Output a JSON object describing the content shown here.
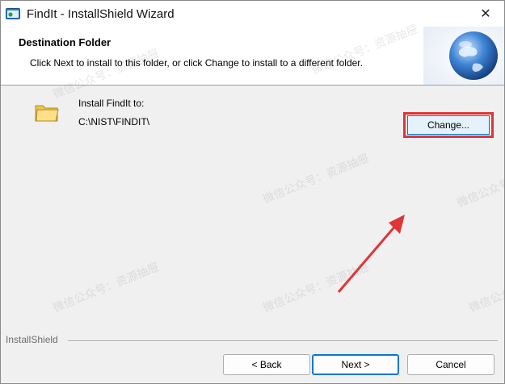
{
  "window": {
    "title": "FindIt - InstallShield Wizard",
    "close_symbol": "✕"
  },
  "banner": {
    "title": "Destination Folder",
    "description": "Click Next to install to this folder, or click Change to install to a different folder."
  },
  "content": {
    "install_label": "Install FindIt to:",
    "install_path": "C:\\NIST\\FINDIT\\",
    "change_label": "Change..."
  },
  "footer": {
    "brand": "InstallShield",
    "back_label": "< Back",
    "next_label": "Next >",
    "cancel_label": "Cancel"
  },
  "watermarks": [
    "微信公众号：资源抽屉",
    "微信公众号：资源抽屉",
    "微信公众号：资源抽屉",
    "微信公众号：资源抽屉",
    "微信公众号：资源抽屉",
    "微信公众号：资源抽屉",
    "微信公众号：资源抽屉"
  ],
  "colors": {
    "annotation_red": "#e03535",
    "button_focus": "#0078d7"
  }
}
